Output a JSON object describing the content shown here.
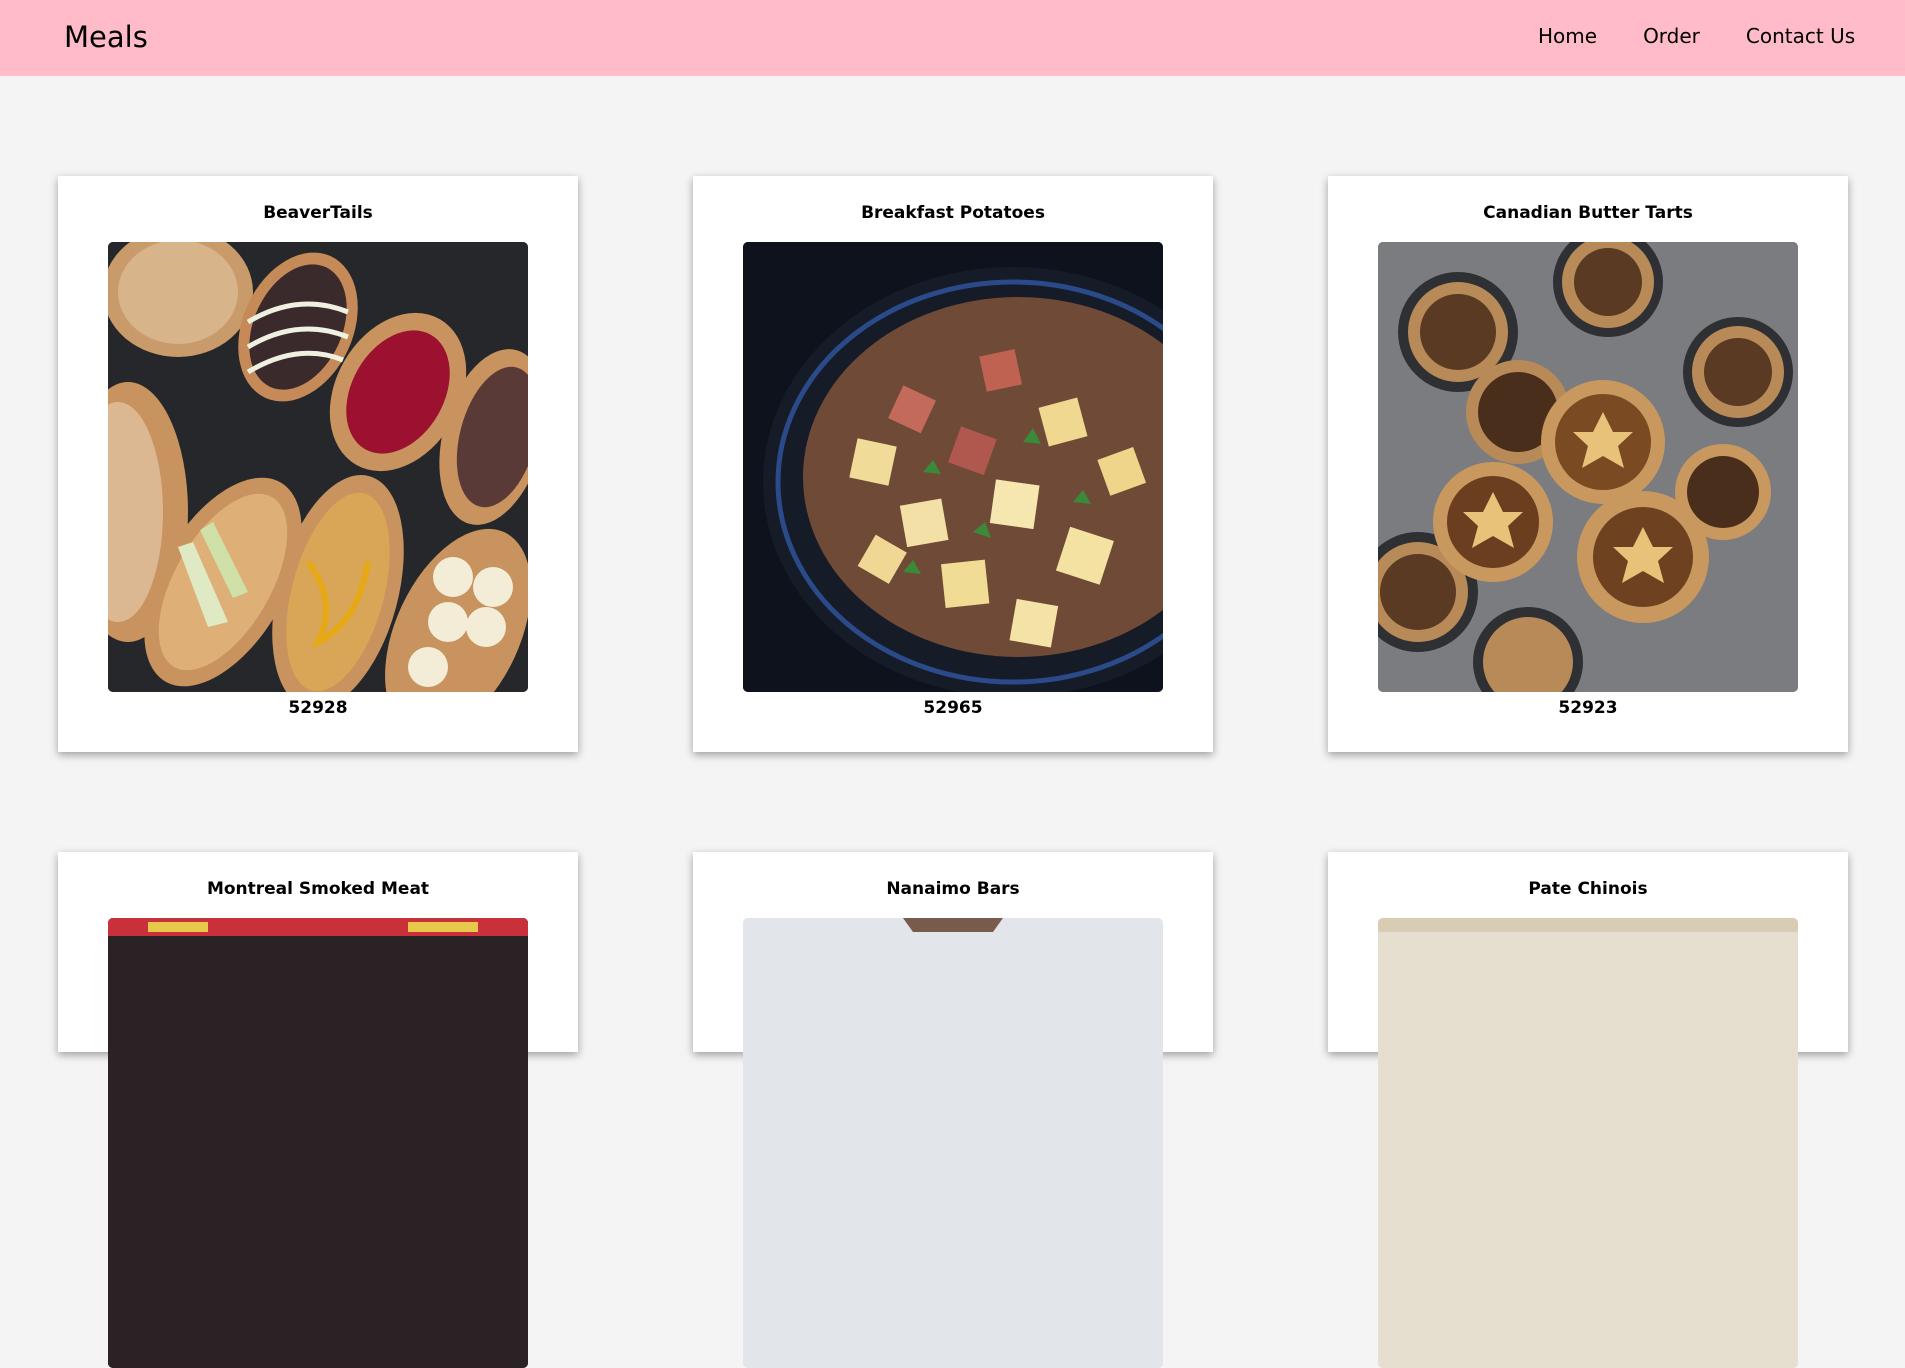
{
  "header": {
    "brand": "Meals",
    "nav": [
      {
        "label": "Home"
      },
      {
        "label": "Order"
      },
      {
        "label": "Contact Us"
      }
    ]
  },
  "meals": [
    {
      "name": "BeaverTails",
      "id": "52928",
      "image_icon": "beavertails-photo"
    },
    {
      "name": "Breakfast Potatoes",
      "id": "52965",
      "image_icon": "breakfast-potatoes-photo"
    },
    {
      "name": "Canadian Butter Tarts",
      "id": "52923",
      "image_icon": "butter-tarts-photo"
    },
    {
      "name": "Montreal Smoked Meat",
      "image_icon": "smoked-meat-photo"
    },
    {
      "name": "Nanaimo Bars",
      "image_icon": "nanaimo-bars-photo"
    },
    {
      "name": "Pate Chinois",
      "image_icon": "pate-chinois-photo"
    }
  ]
}
